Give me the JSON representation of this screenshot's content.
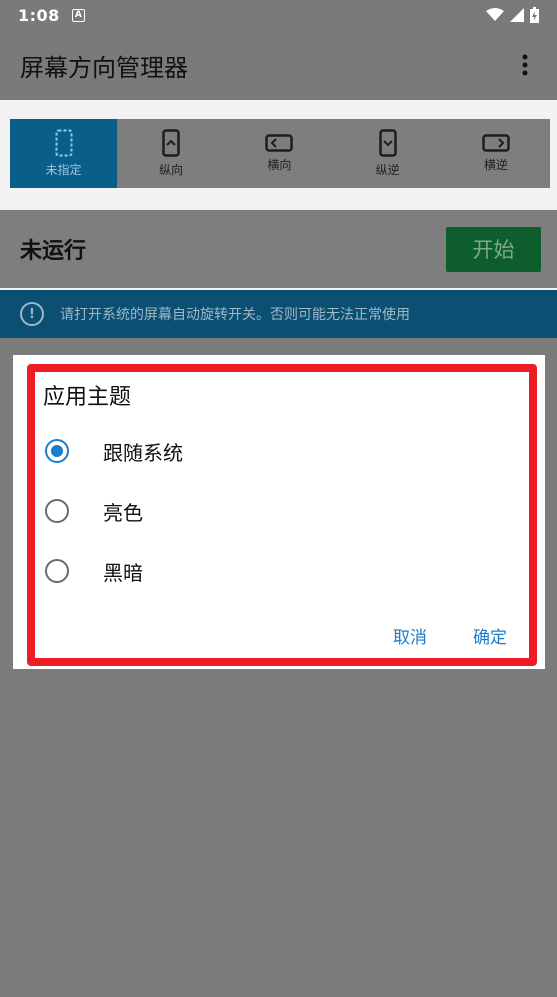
{
  "status_bar": {
    "time": "1:08",
    "notification_icon": "A"
  },
  "app_bar": {
    "title": "屏幕方向管理器",
    "more_icon": "more-vert-icon"
  },
  "orientation_options": [
    {
      "label": "未指定",
      "icon": "unspecified-orientation-icon",
      "active": true
    },
    {
      "label": "纵向",
      "icon": "portrait-icon"
    },
    {
      "label": "横向",
      "icon": "landscape-icon"
    },
    {
      "label": "纵逆",
      "icon": "reverse-portrait-icon"
    },
    {
      "label": "横逆",
      "icon": "reverse-landscape-icon"
    }
  ],
  "run": {
    "status": "未运行",
    "start_label": "开始"
  },
  "info": {
    "text": "请打开系统的屏幕自动旋转开关。否则可能无法正常使用"
  },
  "dialog": {
    "title": "应用主题",
    "options": [
      {
        "label": "跟随系统",
        "checked": true
      },
      {
        "label": "亮色",
        "checked": false
      },
      {
        "label": "黑暗",
        "checked": false
      }
    ],
    "cancel_label": "取消",
    "ok_label": "确定"
  },
  "colors": {
    "accent": "#1a7ccc",
    "highlight": "#ee1d25",
    "start_button": "#0d5e2c"
  }
}
